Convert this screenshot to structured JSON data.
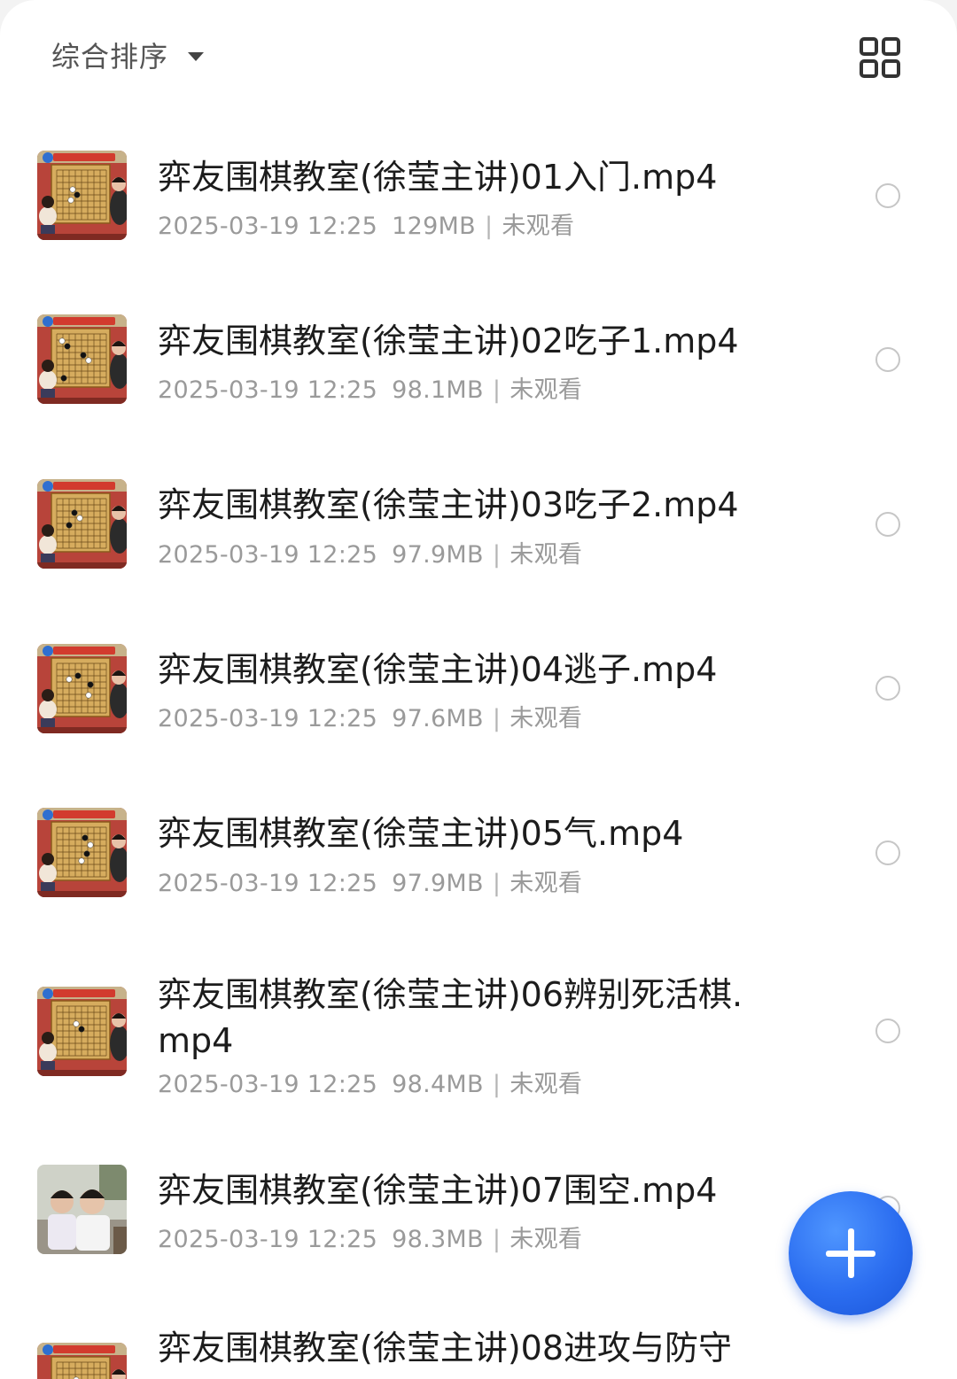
{
  "toolbar": {
    "sort_label": "综合排序",
    "sort_icon": "caret-down-icon",
    "view_toggle_icon": "grid-view-icon"
  },
  "files": [
    {
      "title": "弈友围棋教室(徐莹主讲)01入门.mp4",
      "date": "2025-03-19 12:25",
      "size": "129MB",
      "status": "未观看",
      "thumb": "board"
    },
    {
      "title": "弈友围棋教室(徐莹主讲)02吃子1.mp4",
      "date": "2025-03-19 12:25",
      "size": "98.1MB",
      "status": "未观看",
      "thumb": "board"
    },
    {
      "title": "弈友围棋教室(徐莹主讲)03吃子2.mp4",
      "date": "2025-03-19 12:25",
      "size": "97.9MB",
      "status": "未观看",
      "thumb": "board"
    },
    {
      "title": "弈友围棋教室(徐莹主讲)04逃子.mp4",
      "date": "2025-03-19 12:25",
      "size": "97.6MB",
      "status": "未观看",
      "thumb": "board"
    },
    {
      "title": "弈友围棋教室(徐莹主讲)05气.mp4",
      "date": "2025-03-19 12:25",
      "size": "97.9MB",
      "status": "未观看",
      "thumb": "board"
    },
    {
      "title": "弈友围棋教室(徐莹主讲)06辨别死活棋.mp4",
      "date": "2025-03-19 12:25",
      "size": "98.4MB",
      "status": "未观看",
      "thumb": "board"
    },
    {
      "title": "弈友围棋教室(徐莹主讲)07围空.mp4",
      "date": "2025-03-19 12:25",
      "size": "98.3MB",
      "status": "未观看",
      "thumb": "kids"
    },
    {
      "title": "弈友围棋教室(徐莹主讲)08进攻与防守",
      "date": "",
      "size": "",
      "status": "",
      "thumb": "board"
    }
  ],
  "fab": {
    "icon": "plus-icon"
  },
  "colors": {
    "accent": "#2b6df0",
    "meta": "#9a9a9a",
    "title": "#1c1c1c"
  }
}
